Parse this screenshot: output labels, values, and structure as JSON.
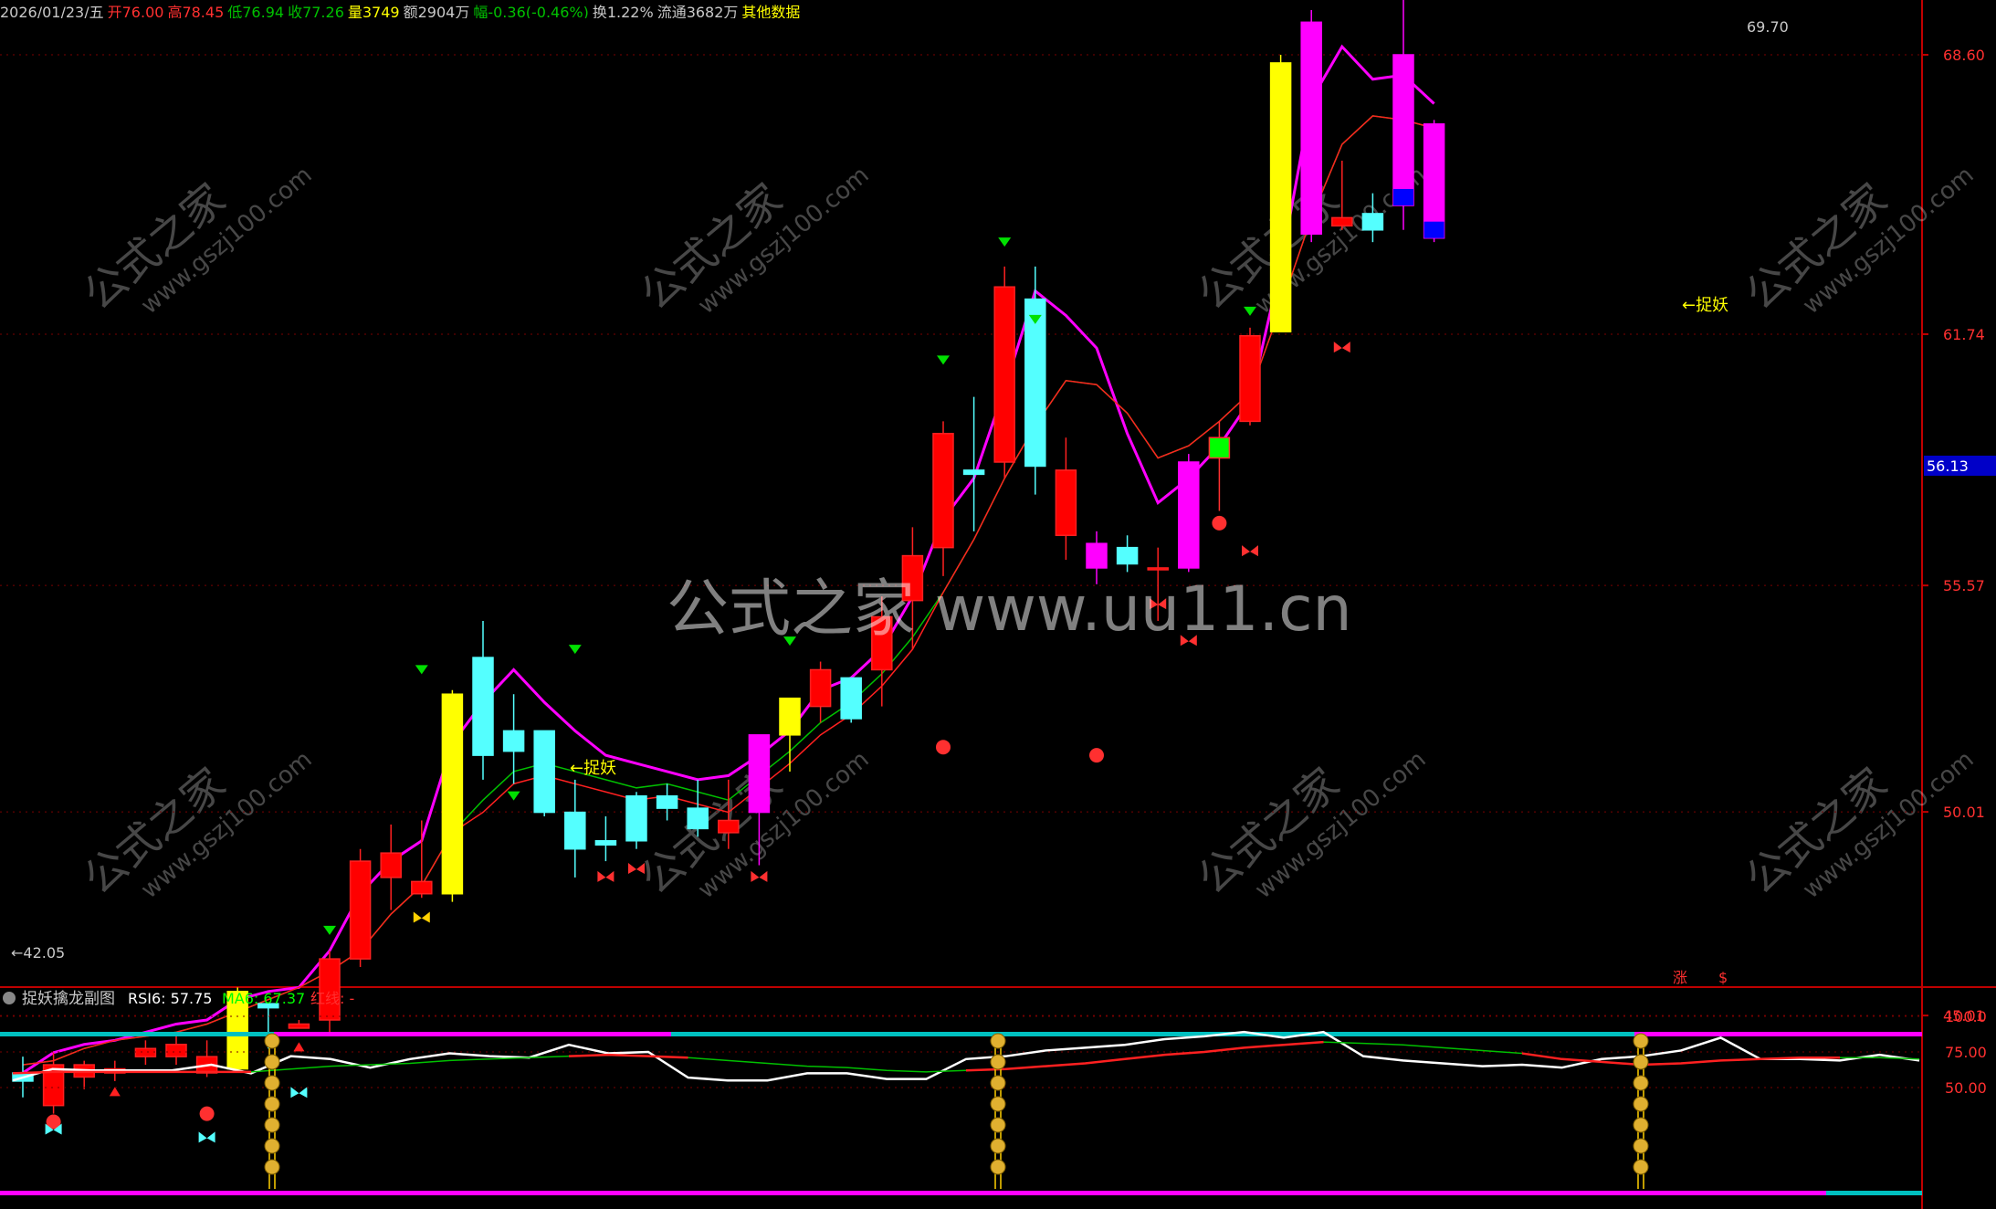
{
  "header": {
    "items": [
      {
        "text": "2026/01/23/五",
        "color": "#c8c8c8"
      },
      {
        "text": "开76.00",
        "color": "#ff3030"
      },
      {
        "text": "高78.45",
        "color": "#ff3030"
      },
      {
        "text": "低76.94",
        "color": "#00c000"
      },
      {
        "text": "收77.26",
        "color": "#00c000"
      },
      {
        "text": "量3749",
        "color": "#ffff00"
      },
      {
        "text": "额2904万",
        "color": "#c8c8c8"
      },
      {
        "text": "幅-0.36(-0.46%)",
        "color": "#00c000"
      },
      {
        "text": "换1.22%",
        "color": "#c8c8c8"
      },
      {
        "text": "流通3682万",
        "color": "#c8c8c8"
      },
      {
        "text": "其他数据",
        "color": "#ffff00"
      }
    ]
  },
  "main_axis": {
    "labels": [
      "68.60",
      "61.74",
      "55.57",
      "50.01",
      "45.01"
    ],
    "current_price": "56.13"
  },
  "sub_axis": {
    "labels": [
      "100.0",
      "75.00",
      "50.00"
    ]
  },
  "sub_header": {
    "title": "捉妖擒龙副图",
    "rsi_label": "RSI6: 57.75",
    "ma_label": "MA6: 67.37",
    "red_label": "红线: -"
  },
  "annotations": {
    "low": "←42.05",
    "high": "69.70",
    "tag1": "←捉妖",
    "tag2": "←捉妖",
    "bottom_marks": [
      "涨",
      "$"
    ]
  },
  "watermarks": {
    "big": "公式之家 www.uu11.cn",
    "small_cn": "公式之家",
    "small_url": "www.gszj100.com"
  },
  "chart_data": [
    {
      "type": "candlestick",
      "ylim": [
        42,
        70
      ],
      "candles": [
        {
          "o": 43.6,
          "h": 44.0,
          "l": 43.0,
          "c": 43.4
        },
        {
          "o": 42.8,
          "h": 44.1,
          "l": 42.6,
          "c": 43.8
        },
        {
          "o": 43.5,
          "h": 43.9,
          "l": 43.2,
          "c": 43.8
        },
        {
          "o": 43.6,
          "h": 43.9,
          "l": 43.4,
          "c": 43.7
        },
        {
          "o": 44.0,
          "h": 44.4,
          "l": 43.8,
          "c": 44.2
        },
        {
          "o": 44.0,
          "h": 44.5,
          "l": 43.8,
          "c": 44.3
        },
        {
          "o": 43.6,
          "h": 44.4,
          "l": 43.5,
          "c": 44.0
        },
        {
          "o": 43.7,
          "h": 45.7,
          "l": 43.6,
          "c": 45.6
        },
        {
          "o": 45.3,
          "h": 45.3,
          "l": 44.2,
          "c": 45.2
        },
        {
          "o": 44.7,
          "h": 44.9,
          "l": 44.7,
          "c": 44.8
        },
        {
          "o": 44.9,
          "h": 46.6,
          "l": 44.6,
          "c": 46.4
        },
        {
          "o": 46.4,
          "h": 49.1,
          "l": 46.2,
          "c": 48.8
        },
        {
          "o": 48.4,
          "h": 49.7,
          "l": 47.6,
          "c": 49.0
        },
        {
          "o": 48.0,
          "h": 49.8,
          "l": 47.9,
          "c": 48.3
        },
        {
          "o": 48.0,
          "h": 53.0,
          "l": 47.8,
          "c": 52.9
        },
        {
          "o": 53.8,
          "h": 54.7,
          "l": 50.8,
          "c": 51.4
        },
        {
          "o": 52.0,
          "h": 52.9,
          "l": 50.7,
          "c": 51.5
        },
        {
          "o": 52.0,
          "h": 52.0,
          "l": 49.9,
          "c": 50.0
        },
        {
          "o": 50.0,
          "h": 50.8,
          "l": 48.4,
          "c": 49.1
        },
        {
          "o": 49.3,
          "h": 49.9,
          "l": 48.8,
          "c": 49.2
        },
        {
          "o": 50.4,
          "h": 50.5,
          "l": 49.1,
          "c": 49.3
        },
        {
          "o": 50.4,
          "h": 50.7,
          "l": 49.8,
          "c": 50.1
        },
        {
          "o": 50.1,
          "h": 50.8,
          "l": 49.4,
          "c": 49.6
        },
        {
          "o": 49.5,
          "h": 50.8,
          "l": 49.1,
          "c": 49.8
        },
        {
          "o": 50.0,
          "h": 51.3,
          "l": 48.7,
          "c": 51.9
        },
        {
          "o": 51.9,
          "h": 52.7,
          "l": 51.0,
          "c": 52.8
        },
        {
          "o": 52.6,
          "h": 53.7,
          "l": 52.2,
          "c": 53.5
        },
        {
          "o": 53.3,
          "h": 53.3,
          "l": 52.2,
          "c": 52.3
        },
        {
          "o": 53.5,
          "h": 55.3,
          "l": 52.6,
          "c": 54.8
        },
        {
          "o": 55.2,
          "h": 57.0,
          "l": 54.0,
          "c": 56.3
        },
        {
          "o": 56.5,
          "h": 59.6,
          "l": 55.8,
          "c": 59.3
        },
        {
          "o": 58.4,
          "h": 60.2,
          "l": 56.9,
          "c": 58.3
        },
        {
          "o": 58.6,
          "h": 63.4,
          "l": 58.2,
          "c": 62.9
        },
        {
          "o": 62.6,
          "h": 63.4,
          "l": 57.8,
          "c": 58.5
        },
        {
          "o": 56.8,
          "h": 59.2,
          "l": 56.2,
          "c": 58.4
        },
        {
          "o": 56.0,
          "h": 56.9,
          "l": 55.6,
          "c": 56.6
        },
        {
          "o": 56.5,
          "h": 56.8,
          "l": 55.9,
          "c": 56.1
        },
        {
          "o": 56.0,
          "h": 56.5,
          "l": 54.7,
          "c": 56.0
        },
        {
          "o": 56.0,
          "h": 58.8,
          "l": 55.9,
          "c": 58.6
        },
        {
          "o": 58.7,
          "h": 59.6,
          "l": 57.4,
          "c": 59.2
        },
        {
          "o": 59.6,
          "h": 61.9,
          "l": 59.5,
          "c": 61.7
        },
        {
          "o": 61.8,
          "h": 68.6,
          "l": 61.8,
          "c": 68.4
        },
        {
          "o": 69.4,
          "h": 69.7,
          "l": 64.0,
          "c": 64.2
        },
        {
          "o": 64.4,
          "h": 66.0,
          "l": 64.3,
          "c": 64.6
        },
        {
          "o": 64.7,
          "h": 65.2,
          "l": 64.0,
          "c": 64.3
        },
        {
          "o": 68.6,
          "h": 70.0,
          "l": 64.3,
          "c": 64.9
        },
        {
          "o": 66.9,
          "h": 67.0,
          "l": 64.0,
          "c": 64.1
        }
      ],
      "ma_short": [
        43.6,
        44.1,
        44.3,
        44.4,
        44.6,
        44.8,
        44.9,
        45.4,
        45.6,
        45.7,
        46.6,
        48.0,
        48.8,
        49.3,
        51.7,
        52.7,
        53.5,
        52.7,
        52.0,
        51.4,
        51.2,
        51.0,
        50.8,
        50.9,
        51.4,
        52.0,
        53.0,
        53.3,
        54.0,
        55.3,
        57.2,
        58.2,
        60.4,
        62.8,
        62.2,
        61.4,
        59.3,
        57.6,
        58.2,
        59.0,
        60.1,
        63.4,
        67.5,
        68.8,
        68.0,
        68.1,
        67.4
      ],
      "ma_long": [
        43.8,
        43.9,
        44.2,
        44.4,
        44.5,
        44.6,
        44.8,
        45.1,
        45.4,
        45.7,
        46.1,
        46.6,
        47.5,
        48.2,
        49.5,
        50.3,
        51.0,
        51.2,
        51.0,
        50.8,
        50.6,
        50.7,
        50.5,
        50.3,
        50.9,
        51.5,
        52.2,
        52.7,
        53.4,
        54.3,
        55.4,
        56.7,
        58.2,
        59.5,
        60.6,
        60.5,
        59.8,
        58.7,
        59.0,
        59.6,
        60.3,
        62.4,
        64.6,
        66.4,
        67.1,
        67.0,
        66.8
      ]
    },
    {
      "type": "line",
      "ylim": [
        0,
        100
      ],
      "ticks": [
        50,
        75,
        100
      ],
      "series": [
        {
          "name": "RSI6",
          "values": [
            55,
            63,
            62,
            62,
            62,
            66,
            60,
            72,
            70,
            64,
            70,
            74,
            72,
            71,
            80,
            74,
            75,
            57,
            55,
            55,
            60,
            60,
            56,
            56,
            70,
            72,
            76,
            78,
            80,
            84,
            86,
            89,
            85,
            89,
            72,
            69,
            67,
            65,
            66,
            64,
            70,
            72,
            76,
            85,
            70,
            70,
            69,
            73,
            69
          ]
        },
        {
          "name": "MA6",
          "values": [
            60,
            61,
            61,
            61,
            61,
            61,
            61,
            63,
            65,
            66,
            67,
            69,
            70,
            71,
            72,
            73,
            72,
            71,
            69,
            67,
            65,
            64,
            62,
            61,
            62,
            63,
            65,
            67,
            70,
            73,
            75,
            78,
            80,
            82,
            81,
            80,
            78,
            76,
            74,
            70,
            68,
            66,
            67,
            69,
            70,
            71,
            71,
            71,
            70
          ]
        }
      ]
    }
  ]
}
